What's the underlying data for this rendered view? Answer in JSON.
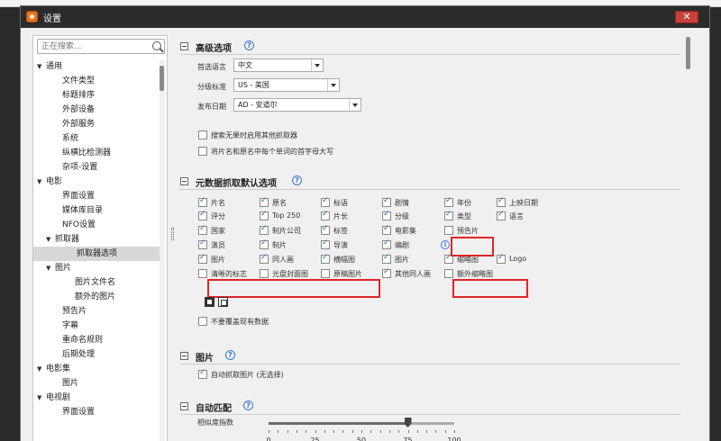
{
  "window": {
    "title": "设置",
    "close_label": "✕"
  },
  "search": {
    "placeholder": "正在搜索..."
  },
  "sidebar": {
    "items": [
      {
        "label": "通用",
        "arrow": "▼"
      },
      {
        "label": "文件类型",
        "arrow": ""
      },
      {
        "label": "标题排序",
        "arrow": ""
      },
      {
        "label": "外部设备",
        "arrow": ""
      },
      {
        "label": "外部服务",
        "arrow": ""
      },
      {
        "label": "系统",
        "arrow": ""
      },
      {
        "label": "纵横比检测器",
        "arrow": ""
      },
      {
        "label": "杂项-设置",
        "arrow": ""
      },
      {
        "label": "电影",
        "arrow": "▼"
      },
      {
        "label": "界面设置",
        "arrow": ""
      },
      {
        "label": "媒体库目录",
        "arrow": ""
      },
      {
        "label": "NFO设置",
        "arrow": ""
      },
      {
        "label": "抓取器",
        "arrow": "▼"
      },
      {
        "label": "抓取器选项",
        "arrow": ""
      },
      {
        "label": "图片",
        "arrow": "▼"
      },
      {
        "label": "图片文件名",
        "arrow": ""
      },
      {
        "label": "额外的图片",
        "arrow": ""
      },
      {
        "label": "预告片",
        "arrow": ""
      },
      {
        "label": "字幕",
        "arrow": ""
      },
      {
        "label": "重命名规则",
        "arrow": ""
      },
      {
        "label": "后期处理",
        "arrow": ""
      },
      {
        "label": "电影集",
        "arrow": "▼"
      },
      {
        "label": "图片",
        "arrow": ""
      },
      {
        "label": "电视剧",
        "arrow": "▼"
      },
      {
        "label": "界面设置",
        "arrow": ""
      }
    ]
  },
  "advanced": {
    "title": "高级选项",
    "help": "?",
    "language_label": "首选语言",
    "language_value": "中文",
    "rating_label": "分级标准",
    "rating_value": "US - 美国",
    "release_label": "发布日期",
    "release_value": "AD - 安道尔",
    "opt1": "搜索无果时启用其他抓取器",
    "opt2": "将片名和原名中每个单词的首字母大写"
  },
  "meta": {
    "title": "元数据抓取默认选项",
    "help": "?",
    "info": "i",
    "checkboxes": [
      {
        "label": "片名",
        "checked": true
      },
      {
        "label": "原名",
        "checked": true
      },
      {
        "label": "标语",
        "checked": true
      },
      {
        "label": "剧情",
        "checked": true
      },
      {
        "label": "年份",
        "checked": true
      },
      {
        "label": "上映日期",
        "checked": true
      },
      {
        "label": "评分",
        "checked": true
      },
      {
        "label": "Top 250",
        "checked": true
      },
      {
        "label": "片长",
        "checked": true
      },
      {
        "label": "分级",
        "checked": true
      },
      {
        "label": "类型",
        "checked": true
      },
      {
        "label": "语言",
        "checked": true
      },
      {
        "label": "国家",
        "checked": true
      },
      {
        "label": "制片公司",
        "checked": true
      },
      {
        "label": "标签",
        "checked": true
      },
      {
        "label": "电影集",
        "checked": true
      },
      {
        "label": "预告片",
        "checked": false
      },
      {
        "label": "演员",
        "checked": true
      },
      {
        "label": "制片",
        "checked": true
      },
      {
        "label": "导演",
        "checked": true
      },
      {
        "label": "编剧",
        "checked": true
      },
      {
        "label": "图片",
        "checked": true
      },
      {
        "label": "同人画",
        "checked": true
      },
      {
        "label": "横幅图",
        "checked": true
      },
      {
        "label": "图片",
        "checked": true
      },
      {
        "label": "缩略图",
        "checked": true
      },
      {
        "label": "Logo",
        "checked": true
      },
      {
        "label": "清晰的标志",
        "checked": false
      },
      {
        "label": "光盘封面图",
        "checked": false
      },
      {
        "label": "原稿图片",
        "checked": false
      },
      {
        "label": "其他同人画",
        "checked": true
      },
      {
        "label": "额外缩略图",
        "checked": false
      }
    ],
    "no_overwrite": "不要覆盖现有数据"
  },
  "images": {
    "title": "图片",
    "help": "?",
    "auto_fetch": "自动抓取图片 (无选择)"
  },
  "auto_match": {
    "title": "自动匹配",
    "help": "?",
    "similarity_label": "相似度指数",
    "value": 75,
    "min": 0,
    "max": 100,
    "tick_labels": [
      "0",
      "25",
      "50",
      "75",
      "100"
    ]
  }
}
